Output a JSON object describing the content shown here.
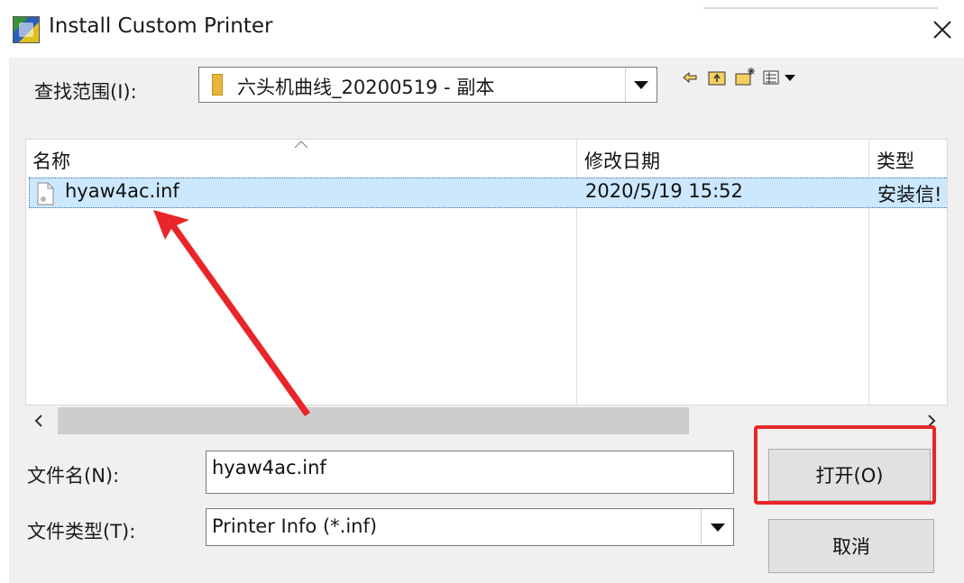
{
  "window": {
    "title": "Install Custom Printer",
    "app_icon": "printer-setup-icon",
    "close_icon": "close-x-icon"
  },
  "look_in": {
    "label": "查找范围(I):",
    "value": "六头机曲线_20200519 - 副本",
    "folder_icon": "folder-icon",
    "toolbar_icons": [
      "back-icon",
      "up-folder-icon",
      "new-folder-icon",
      "view-menu-icon"
    ]
  },
  "list": {
    "columns": [
      "名称",
      "修改日期",
      "类型"
    ],
    "rows": [
      {
        "name": "hyaw4ac.inf",
        "modified": "2020/5/19 15:52",
        "type": "安装信!",
        "icon": "inf-file-icon",
        "selected": true
      }
    ],
    "sort_indicator": "sort-ascending-icon"
  },
  "scrollbar": {
    "left_icon": "scroll-left-icon",
    "right_icon": "scroll-right-icon"
  },
  "filename": {
    "label": "文件名(N):",
    "value": "hyaw4ac.inf"
  },
  "filetype": {
    "label": "文件类型(T):",
    "value": "Printer Info (*.inf)"
  },
  "buttons": {
    "open": "打开(O)",
    "cancel": "取消"
  },
  "annotations": {
    "highlight_color": "#e8262a",
    "arrow_color": "#e8262a"
  },
  "colors": {
    "selection": "#cce8ff",
    "dialog_bg": "#f0f0f0"
  }
}
